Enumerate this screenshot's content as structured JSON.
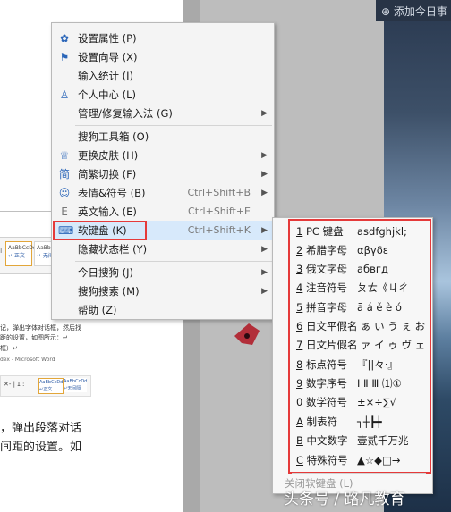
{
  "background": {
    "add_today_text": "⊕ 添加今日事",
    "ribbon_styles": [
      {
        "sample": "AaBbCcDd",
        "name": "↵ 正文",
        "selected": true
      },
      {
        "sample": "AaBbCcDd",
        "name": "↵ 无间",
        "selected": false
      }
    ],
    "ribbon_prefix": "I",
    "small_lines": [
      "记，弹出字体对话框，然后找",
      "距的设置，如图所示：↵",
      "框）↵",
      "dex - Microsoft Word"
    ],
    "mini_ribbon_text": "✕- | ⵊ :",
    "mini_styles": [
      "AaBbCcDd ↵正文",
      "AaBbCcDd ↵无间隔"
    ],
    "doc_lines": [
      "，弹出段落对话",
      "间距的设置。如"
    ]
  },
  "menu": {
    "items": [
      {
        "icon": "gear-icon",
        "glyph": "✿",
        "label": "设置属性 (P)",
        "shortcut": "",
        "arrow": false
      },
      {
        "icon": "flag-icon",
        "glyph": "⚑",
        "label": "设置向导 (X)",
        "shortcut": "",
        "arrow": false
      },
      {
        "icon": "",
        "glyph": "",
        "label": "输入统计 (I)",
        "shortcut": "",
        "arrow": false
      },
      {
        "icon": "user-icon",
        "glyph": "♙",
        "label": "个人中心 (L)",
        "shortcut": "",
        "arrow": false
      },
      {
        "icon": "",
        "glyph": "",
        "label": "管理/修复输入法 (G)",
        "shortcut": "",
        "arrow": true
      },
      {
        "icon": "",
        "glyph": "",
        "label": "搜狗工具箱 (O)",
        "shortcut": "",
        "arrow": false
      },
      {
        "icon": "shirt-icon",
        "glyph": "♕",
        "label": "更换皮肤 (H)",
        "shortcut": "",
        "arrow": true
      },
      {
        "icon": "convert-icon",
        "glyph": "简",
        "label": "简繁切换 (F)",
        "shortcut": "",
        "arrow": true
      },
      {
        "icon": "smiley-icon",
        "glyph": "☺",
        "label": "表情&符号 (B)",
        "shortcut": "Ctrl+Shift+B",
        "arrow": true
      },
      {
        "icon": "english-icon",
        "glyph": "E",
        "label": "英文输入 (E)",
        "shortcut": "Ctrl+Shift+E",
        "arrow": false
      },
      {
        "icon": "keyboard-icon",
        "glyph": "⌨",
        "label": "软键盘 (K)",
        "shortcut": "Ctrl+Shift+K",
        "arrow": true
      },
      {
        "icon": "",
        "glyph": "",
        "label": "隐藏状态栏 (Y)",
        "shortcut": "",
        "arrow": true
      },
      {
        "icon": "",
        "glyph": "",
        "label": "今日搜狗 (J)",
        "shortcut": "",
        "arrow": true
      },
      {
        "icon": "",
        "glyph": "",
        "label": "搜狗搜索 (M)",
        "shortcut": "",
        "arrow": true
      },
      {
        "icon": "",
        "glyph": "",
        "label": "帮助 (Z)",
        "shortcut": "",
        "arrow": false
      }
    ],
    "highlighted_index": 10
  },
  "keyboard_submenu": {
    "items": [
      {
        "key": "1",
        "label": " PC 键盘",
        "example": "asdfghjkl;"
      },
      {
        "key": "2",
        "label": " 希腊字母",
        "example": "αβγδε"
      },
      {
        "key": "3",
        "label": " 俄文字母",
        "example": "абвгд"
      },
      {
        "key": "4",
        "label": " 注音符号",
        "example": "ㄆㄊ《ㄐㄔ"
      },
      {
        "key": "5",
        "label": " 拼音字母",
        "example": "ā á ě è ó"
      },
      {
        "key": "6",
        "label": " 日文平假名",
        "example": "ぁ い う ぇ お"
      },
      {
        "key": "7",
        "label": " 日文片假名",
        "example": "ァ イ ゥ ヴ ェ"
      },
      {
        "key": "8",
        "label": " 标点符号",
        "example": "『||々·』"
      },
      {
        "key": "9",
        "label": " 数字序号",
        "example": "Ⅰ Ⅱ Ⅲ ⑴①"
      },
      {
        "key": "0",
        "label": " 数学符号",
        "example": "±×÷∑√"
      },
      {
        "key": "A",
        "label": " 制表符",
        "example": "┐┼┣┿"
      },
      {
        "key": "B",
        "label": " 中文数字",
        "example": "壹贰千万兆"
      },
      {
        "key": "C",
        "label": " 特殊符号",
        "example": "▲☆◆□→"
      }
    ],
    "close_label": "关闭软键盘 (L)"
  },
  "watermark": "头条号 / 路凡教育",
  "colors": {
    "highlight": "#d7e9fb",
    "annotation_red": "#e53a3a",
    "icon_blue": "#2b66b9"
  }
}
